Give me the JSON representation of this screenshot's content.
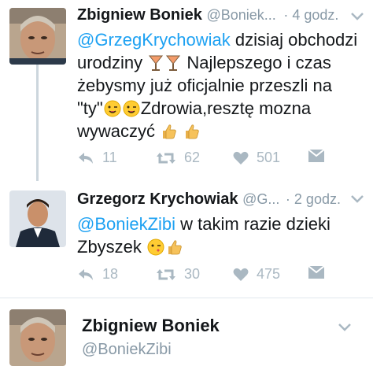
{
  "tweets": [
    {
      "name": "Zbigniew Boniek",
      "handle": "@Boniek...",
      "time": "· 4 godz.",
      "text": {
        "mention": "@GrzegKrychowiak",
        "l1": " dzisiaj obchodzi",
        "l2a": "urodziny",
        "l2b": "Najlepszego i czas",
        "l3": "żebysmy już oficjalnie przeszli na",
        "l4a": "\"ty\"",
        "l4b": "Zdrowia,resztę mozna",
        "l5": "wywaczyć"
      },
      "replies": "11",
      "retweets": "62",
      "likes": "501"
    },
    {
      "name": "Grzegorz Krychowiak",
      "handle": "@G...",
      "time": "· 2 godz.",
      "text": {
        "mention": "@BoniekZibi",
        "l1": " w takim razie dzieki",
        "l2": "Zbyszek"
      },
      "replies": "18",
      "retweets": "30",
      "likes": "475"
    },
    {
      "name": "Zbigniew Boniek",
      "handle": "@BoniekZibi"
    }
  ],
  "icons": {
    "reply": "reply-icon",
    "retweet": "retweet-icon",
    "like": "heart-icon",
    "dm": "envelope-icon",
    "menu": "chevron-down-icon"
  },
  "colors": {
    "mention": "#1da1f2",
    "muted": "#8899a6",
    "icon": "#aab8c2"
  }
}
